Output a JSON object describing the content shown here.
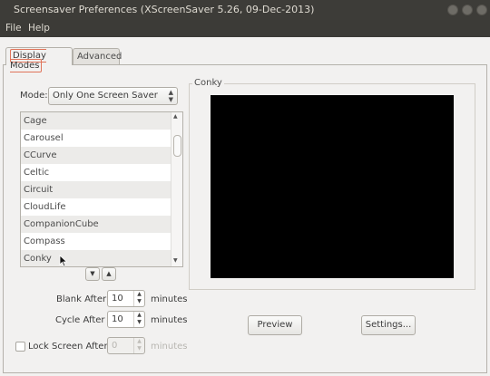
{
  "window": {
    "title": "Screensaver Preferences  (XScreenSaver 5.26, 09-Dec-2013)"
  },
  "menu": {
    "file": "File",
    "help": "Help"
  },
  "tabs": [
    {
      "label": "Display Modes",
      "active": true
    },
    {
      "label": "Advanced",
      "active": false
    }
  ],
  "mode": {
    "label": "Mode:",
    "value": "Only One Screen Saver",
    "arrows": "▲▼"
  },
  "savers": [
    "Cage",
    "Carousel",
    "CCurve",
    "Celtic",
    "Circuit",
    "CloudLife",
    "CompanionCube",
    "Compass",
    "Conky"
  ],
  "selected_saver": "Conky",
  "list_nav": {
    "down": "▼",
    "up": "▲"
  },
  "blank_after": {
    "label": "Blank After",
    "value": "10",
    "unit": "minutes"
  },
  "cycle_after": {
    "label": "Cycle After",
    "value": "10",
    "unit": "minutes"
  },
  "lock_screen": {
    "label": "Lock Screen After",
    "value": "0",
    "unit": "minutes",
    "checked": false
  },
  "preview": {
    "frame_title": "Conky",
    "preview_label": "Preview",
    "settings_label": "Settings..."
  },
  "colors": {
    "titlebar": "#3d3c38",
    "accent": "#e0745a",
    "preview_bg": "#000000"
  }
}
